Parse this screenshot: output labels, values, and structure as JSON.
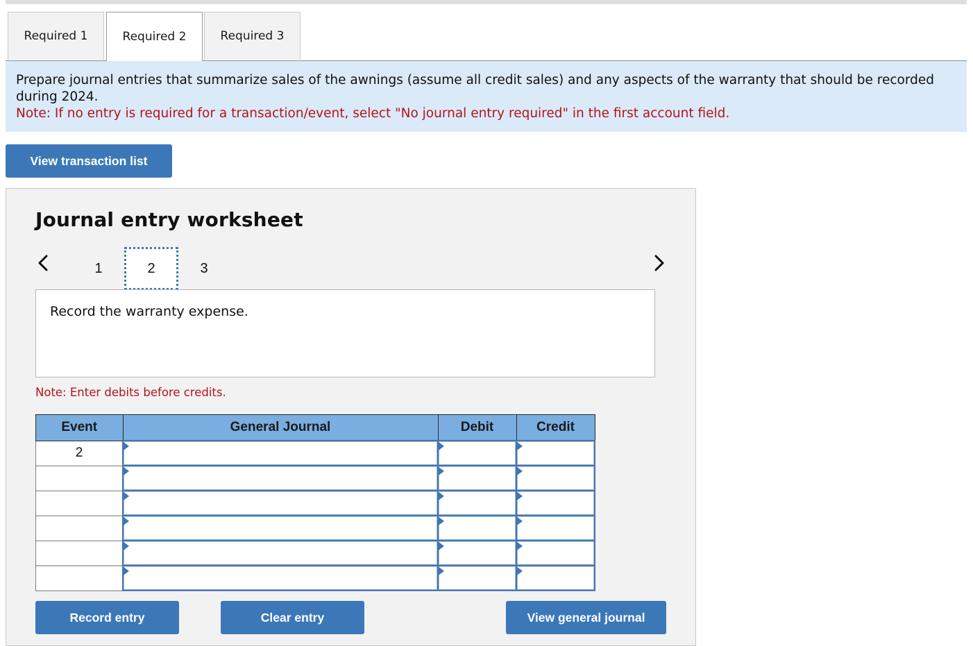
{
  "tabs": [
    {
      "label": "Required 1",
      "active": false
    },
    {
      "label": "Required 2",
      "active": true
    },
    {
      "label": "Required 3",
      "active": false
    }
  ],
  "instructions": {
    "text": "Prepare journal entries that summarize sales of the awnings (assume all credit sales) and any aspects of the warranty that should be recorded during 2024.",
    "note": "Note: If no entry is required for a transaction/event, select \"No journal entry required\" in the first account field."
  },
  "buttons": {
    "view_transaction_list": "View transaction list",
    "record_entry": "Record entry",
    "clear_entry": "Clear entry",
    "view_general_journal": "View general journal"
  },
  "worksheet": {
    "title": "Journal entry worksheet",
    "pages": [
      "1",
      "2",
      "3"
    ],
    "current_page": "2",
    "prev_icon": "chevron-left-icon",
    "next_icon": "chevron-right-icon",
    "description": "Record the warranty expense.",
    "note": "Note: Enter debits before credits."
  },
  "journal_table": {
    "headers": {
      "event": "Event",
      "general_journal": "General Journal",
      "debit": "Debit",
      "credit": "Credit"
    },
    "rows": [
      {
        "event": "2",
        "account": "",
        "debit": "",
        "credit": ""
      },
      {
        "event": "",
        "account": "",
        "debit": "",
        "credit": ""
      },
      {
        "event": "",
        "account": "",
        "debit": "",
        "credit": ""
      },
      {
        "event": "",
        "account": "",
        "debit": "",
        "credit": ""
      },
      {
        "event": "",
        "account": "",
        "debit": "",
        "credit": ""
      },
      {
        "event": "",
        "account": "",
        "debit": "",
        "credit": ""
      }
    ]
  },
  "colors": {
    "accent": "#3c78b8",
    "header_bg": "#7aaee0",
    "instruction_bg": "#dbeaf8",
    "note_red": "#b3131d"
  }
}
